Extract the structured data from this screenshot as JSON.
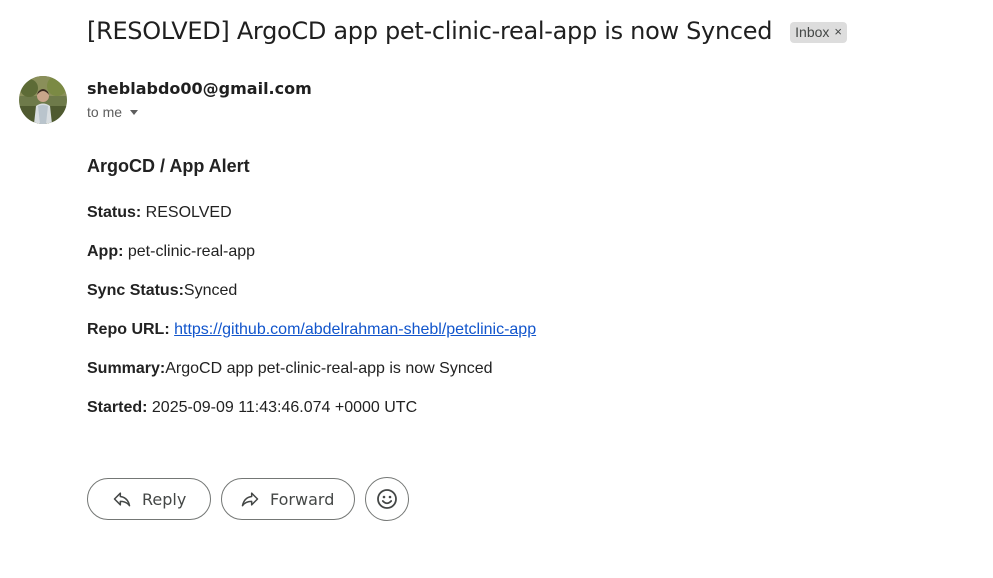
{
  "email": {
    "subject": "[RESOLVED] ArgoCD app pet-clinic-real-app is now Synced",
    "label": "Inbox",
    "sender": "sheblabdo00@gmail.com",
    "recipient": "to me"
  },
  "body": {
    "title": "ArgoCD / App Alert",
    "fields": [
      {
        "key": "Status:",
        "value": " RESOLVED"
      },
      {
        "key": "App:",
        "value": " pet-clinic-real-app"
      },
      {
        "key": "Sync Status:",
        "value": "Synced"
      },
      {
        "key": "Repo URL:",
        "value": "https://github.com/abdelrahman-shebl/petclinic-app"
      },
      {
        "key": "Summary:",
        "value": "ArgoCD app pet-clinic-real-app is now Synced"
      },
      {
        "key": "Started:",
        "value": " 2025-09-09 11:43:46.074 +0000 UTC"
      }
    ]
  },
  "actions": {
    "reply_label": "Reply",
    "forward_label": "Forward",
    "reply_icon": "reply-icon",
    "forward_icon": "forward-icon",
    "emoji_icon": "emoji-icon"
  }
}
